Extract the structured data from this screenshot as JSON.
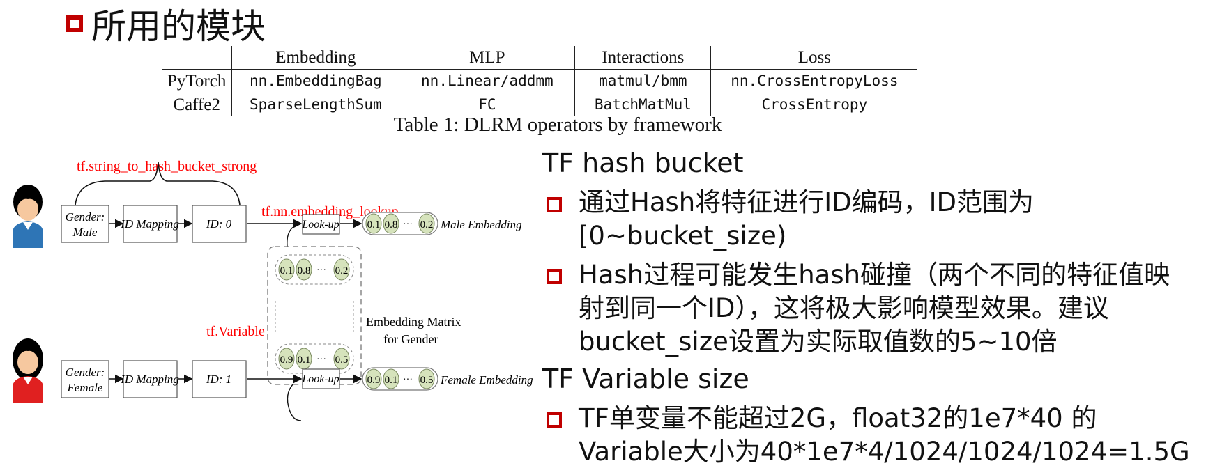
{
  "page": {
    "title": "所用的模块"
  },
  "table": {
    "headers": [
      "",
      "Embedding",
      "MLP",
      "Interactions",
      "Loss"
    ],
    "rows": [
      [
        "PyTorch",
        "nn.EmbeddingBag",
        "nn.Linear/addmm",
        "matmul/bmm",
        "nn.CrossEntropyLoss"
      ],
      [
        "Caffe2",
        "SparseLengthSum",
        "FC",
        "BatchMatMul",
        "CrossEntropy"
      ]
    ],
    "caption": "Table 1: DLRM operators by framework"
  },
  "diagram": {
    "label_hash": "tf.string_to_hash_bucket_strong",
    "label_lookup": "tf.nn.embedding_lookup",
    "label_variable": "tf.Variable",
    "male": {
      "feature_line1": "Gender:",
      "feature_line2": "Male",
      "id_mapping": "ID Mapping",
      "id": "ID: 0",
      "lookup": "Look-up",
      "values": [
        "0.1",
        "0.8",
        "0.2"
      ],
      "embedding_label": "Male Embedding"
    },
    "female": {
      "feature_line1": "Gender:",
      "feature_line2": "Female",
      "id_mapping": "ID Mapping",
      "id": "ID: 1",
      "lookup": "Look-up",
      "values": [
        "0.9",
        "0.1",
        "0.5"
      ],
      "embedding_label": "Female Embedding"
    },
    "matrix": {
      "row1": [
        "0.1",
        "0.8",
        "0.2"
      ],
      "row2": [
        "0.9",
        "0.1",
        "0.5"
      ],
      "label_line1": "Embedding Matrix",
      "label_line2": "for Gender"
    },
    "ellipsis": "···"
  },
  "right": {
    "heading1": "TF hash bucket",
    "bullet1_line1": "通过Hash将特征进行ID编码，ID范围为",
    "bullet1_line2": "[0~bucket_size)",
    "bullet2_line1": "Hash过程可能发生hash碰撞（两个不同的特征值映",
    "bullet2_line2": "射到同一个ID），这将极大影响模型效果。建议",
    "bullet2_line3": "bucket_size设置为实际取值数的5~10倍",
    "heading2": "TF Variable size",
    "bullet3_line1": "TF单变量不能超过2G，float32的1e7*40 的",
    "bullet3_line2": "Variable大小为40*1e7*4/1024/1024/1024=1.5G"
  },
  "colors": {
    "accent": "#c00000",
    "label_red": "#ff0000",
    "cell_green": "#d6e3bc",
    "male_shirt": "#2e75b6",
    "female_shirt": "#e02020"
  }
}
